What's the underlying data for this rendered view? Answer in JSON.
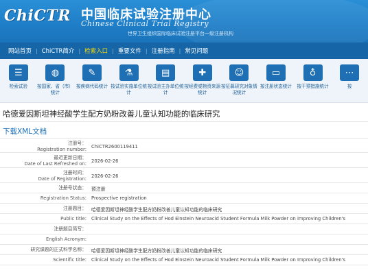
{
  "header": {
    "logo_text": "ChiCTR",
    "site_name_cn": "中国临床试验注册中心",
    "site_name_en": "Chinese Clinical Trial Registry",
    "subtitle": "世界卫生组织国际临床试验注册平台一级注册机构"
  },
  "nav": {
    "items": [
      "网站首页",
      "ChiCTR简介",
      "检索入口",
      "重要文件",
      "注册指南",
      "常见问题"
    ],
    "active_index": 2
  },
  "toolbar": {
    "items": [
      {
        "icon": "list-icon",
        "label": "检索试验"
      },
      {
        "icon": "world-map-icon",
        "label": "按国家、省（市）统计"
      },
      {
        "icon": "dna-icon",
        "label": "按疾病代码统计"
      },
      {
        "icon": "flask-icon",
        "label": "按试验实施单位统计"
      },
      {
        "icon": "clipboard-icon",
        "label": "按试验主办单位统计"
      },
      {
        "icon": "medkit-icon",
        "label": "按经费或物资来源统计"
      },
      {
        "icon": "people-icon",
        "label": "按征募研究对象情况统计"
      },
      {
        "icon": "registration-icon",
        "label": "按注册状态统计"
      },
      {
        "icon": "intervention-icon",
        "label": "按干预措施统计"
      },
      {
        "icon": "more-icon",
        "label": "按"
      }
    ]
  },
  "page": {
    "title": "哈德爱因斯坦神经酸学生配方奶粉改善儿童认知功能的临床研究",
    "download_xml": "下载XML文档"
  },
  "details": [
    {
      "label_cn": "注册号：",
      "label_en": "Registration number:",
      "value": "ChiCTR2600119411"
    },
    {
      "label_cn": "最近更新日期：",
      "label_en": "Date of Last Refreshed on:",
      "value": "2026-02-26"
    },
    {
      "label_cn": "注册时间：",
      "label_en": "Date of Registration:",
      "value": "2026-02-26"
    },
    {
      "label_cn": "注册号状态：",
      "label_en": "",
      "value": "预注册"
    },
    {
      "label_cn": "",
      "label_en": "Registration Status:",
      "value": "Prospective registration"
    },
    {
      "label_cn": "注册题目：",
      "label_en": "",
      "value": "哈德爱因斯坦神经酸学生配方奶粉改善儿童认知功能的临床研究"
    },
    {
      "label_cn": "",
      "label_en": "Public title:",
      "value": "Clinical Study on the Effects of Hod Einstein Neuroacid Student Formula Milk Powder on Improving Children's"
    },
    {
      "label_cn": "注册题目简写：",
      "label_en": "",
      "value": ""
    },
    {
      "label_cn": "",
      "label_en": "English Acronym:",
      "value": ""
    },
    {
      "label_cn": "研究课题的正式科学名称：",
      "label_en": "",
      "value": "哈德爱因斯坦神经酸学生配方奶粉改善儿童认知功能的临床研究"
    },
    {
      "label_cn": "",
      "label_en": "Scientific title:",
      "value": "Clinical Study on the Effects of Hod Einstein Neuroacid Student Formula Milk Powder on Improving Children's"
    }
  ]
}
